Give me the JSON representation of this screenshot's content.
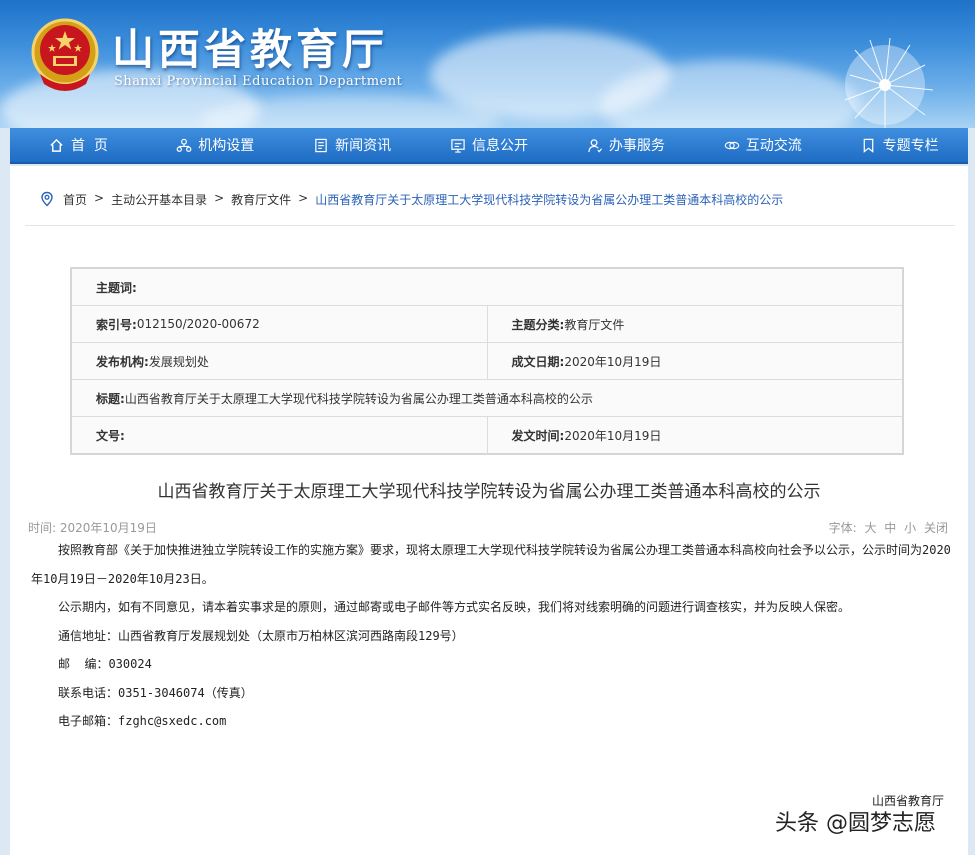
{
  "header": {
    "title": "山西省教育厅",
    "subtitle": "Shanxi Provincial Education Department",
    "emblem_icon": "national-emblem-icon"
  },
  "nav": [
    {
      "label": "首  页",
      "icon": "home-icon"
    },
    {
      "label": "机构设置",
      "icon": "org-chart-icon"
    },
    {
      "label": "新闻资讯",
      "icon": "news-icon"
    },
    {
      "label": "信息公开",
      "icon": "info-icon"
    },
    {
      "label": "办事服务",
      "icon": "service-icon"
    },
    {
      "label": "互动交流",
      "icon": "chat-icon"
    },
    {
      "label": "专题专栏",
      "icon": "bookmark-icon"
    }
  ],
  "breadcrumb": {
    "items": [
      "首页",
      "主动公开基本目录",
      "教育厅文件"
    ],
    "separator": ">",
    "current": "山西省教育厅关于太原理工大学现代科技学院转设为省属公办理工类普通本科高校的公示"
  },
  "meta": {
    "subject_words": {
      "key": "主题词:",
      "value": ""
    },
    "index_no": {
      "key": "索引号:",
      "value": "012150/2020-00672"
    },
    "subject_class": {
      "key": "主题分类:",
      "value": "教育厅文件"
    },
    "publisher": {
      "key": "发布机构:",
      "value": "发展规划处"
    },
    "written_date": {
      "key": "成文日期:",
      "value": "2020年10月19日"
    },
    "title": {
      "key": "标题:",
      "value": "山西省教育厅关于太原理工大学现代科技学院转设为省属公办理工类普通本科高校的公示"
    },
    "doc_no": {
      "key": "文号:",
      "value": ""
    },
    "publish_time": {
      "key": "发文时间:",
      "value": "2020年10月19日"
    }
  },
  "article": {
    "title": "山西省教育厅关于太原理工大学现代科技学院转设为省属公办理工类普通本科高校的公示",
    "time_label": "时间: 2020年10月19日",
    "font_size": {
      "label": "字体:",
      "large": "大",
      "medium": "中",
      "small": "小",
      "close": "关闭"
    },
    "paragraphs": [
      "按照教育部《关于加快推进独立学院转设工作的实施方案》要求，现将太原理工大学现代科技学院转设为省属公办理工类普通本科高校向社会予以公示，公示时间为2020年10月19日－2020年10月23日。",
      "公示期内，如有不同意见，请本着实事求是的原则，通过邮寄或电子邮件等方式实名反映，我们将对线索明确的问题进行调查核实，并为反映人保密。",
      "通信地址：山西省教育厅发展规划处（太原市万柏林区滨河西路南段129号）",
      "邮  编：030024",
      "联系电话：0351-3046074（传真）",
      "电子邮箱：fzghc@sxedc.com"
    ],
    "signature": "山西省教育厅"
  },
  "watermark": "头条 @圆梦志愿"
}
